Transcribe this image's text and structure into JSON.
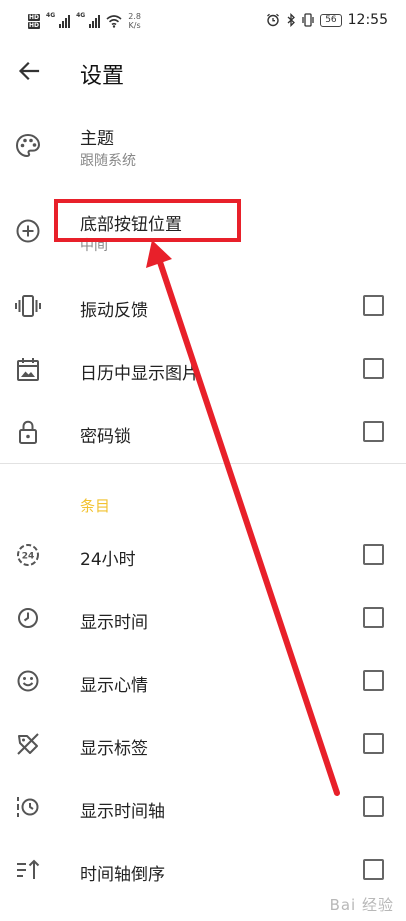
{
  "status_bar": {
    "hd_1": "HD",
    "hd_2": "HD",
    "net_1": "4G",
    "net_2": "4G",
    "speed_value": "2.8",
    "speed_unit": "K/s",
    "battery": "56",
    "time": "12:55"
  },
  "header": {
    "title": "设置"
  },
  "settings": {
    "theme_label": "主题",
    "theme_value": "跟随系统",
    "bottom_button_label": "底部按钮位置",
    "bottom_button_value": "中间",
    "vibration_label": "振动反馈",
    "calendar_image_label": "日历中显示图片",
    "password_lock_label": "密码锁"
  },
  "entries_section": {
    "title": "条目",
    "hour24_label": "24小时",
    "show_time_label": "显示时间",
    "show_mood_label": "显示心情",
    "show_tags_label": "显示标签",
    "show_timeline_label": "显示时间轴",
    "timeline_reverse_label": "时间轴倒序"
  },
  "checkboxes": {
    "vibration": false,
    "calendar_image": false,
    "password_lock": false,
    "hour24": false,
    "show_time": false,
    "show_mood": false,
    "show_tags": false,
    "show_timeline": false,
    "timeline_reverse": false
  },
  "watermark": "Bai 经验",
  "colors": {
    "accent": "#f2c230",
    "annotation": "#e8202a",
    "icon": "#555555"
  }
}
